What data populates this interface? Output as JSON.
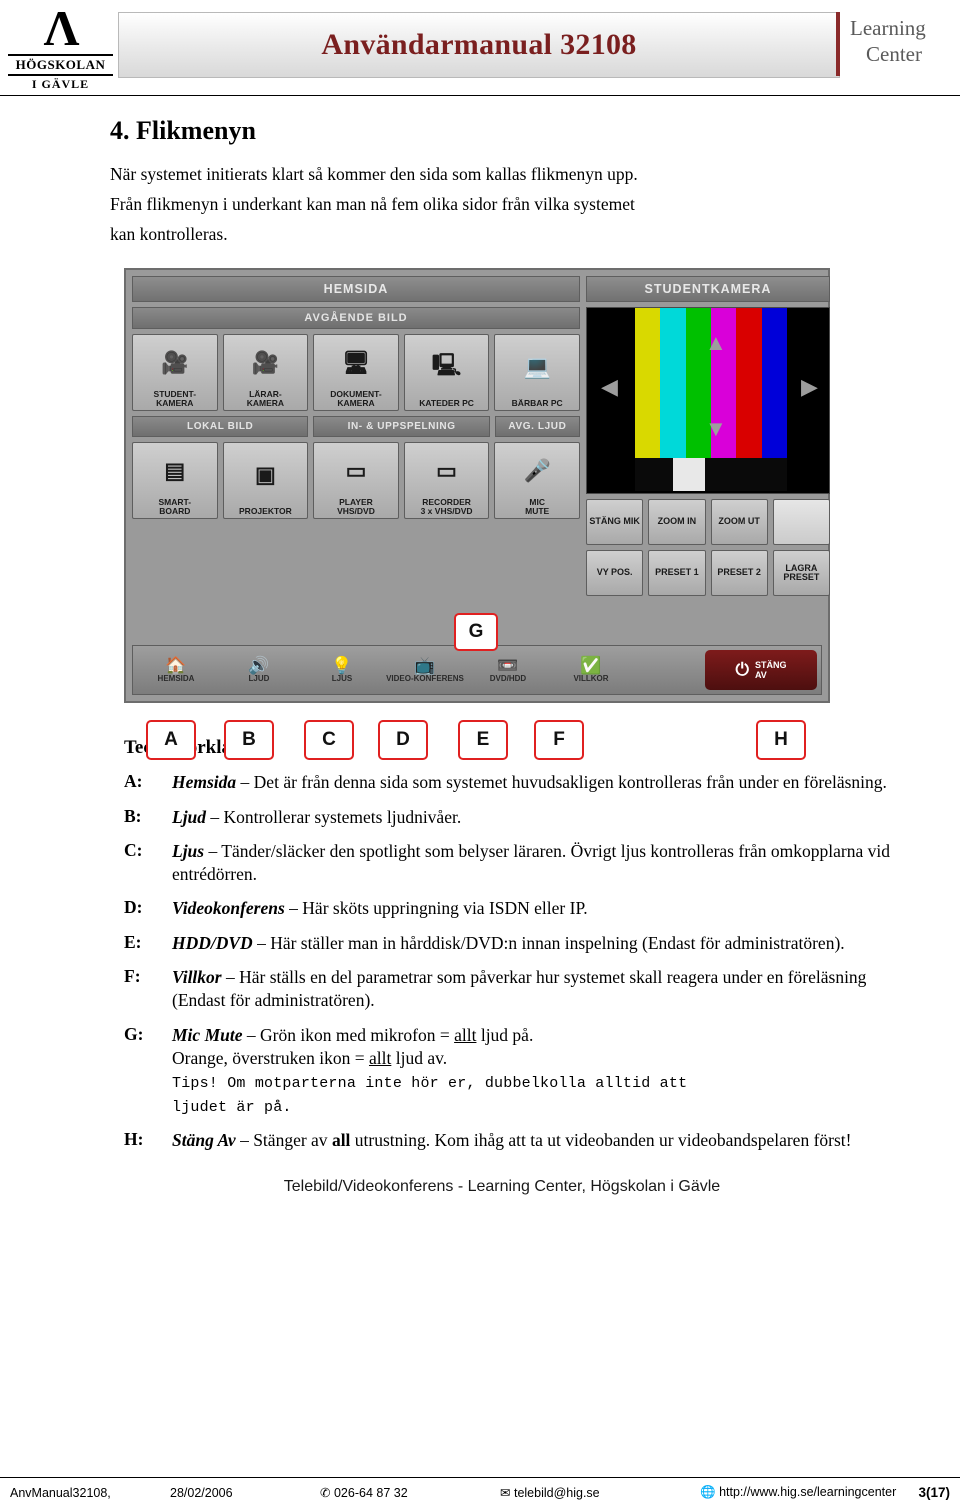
{
  "header": {
    "university_mark": "Λ",
    "university_name": "HÖGSKOLAN",
    "university_city": "I GÄVLE",
    "doc_title": "Användarmanual 32108",
    "lc_line1": "Learning",
    "lc_line2": "Center"
  },
  "section": {
    "heading": "4. Flikmenyn",
    "intro_line1": "När systemet initierats klart så kommer den sida som kallas flikmenyn upp.",
    "intro_line2": "Från flikmenyn i underkant kan man nå fem olika sidor från vilka systemet",
    "intro_line3": "kan kontrolleras."
  },
  "panel": {
    "tab_home": "HEMSIDA",
    "tab_student_camera": "STUDENTKAMERA",
    "sub_outgoing": "AVGÅENDE BILD",
    "sources": [
      {
        "line1": "STUDENT-",
        "line2": "KAMERA",
        "icon": "camera-icon"
      },
      {
        "line1": "LÄRAR-",
        "line2": "KAMERA",
        "icon": "camera-icon"
      },
      {
        "line1": "DOKUMENT-",
        "line2": "KAMERA",
        "icon": "document-camera-icon"
      },
      {
        "line1": "KATEDER PC",
        "line2": "",
        "icon": "desktop-pc-icon"
      },
      {
        "line1": "BÄRBAR PC",
        "line2": "",
        "icon": "laptop-icon"
      }
    ],
    "sub_local": "LOKAL BILD",
    "sub_inrec": "IN- & UPPSPELNING",
    "sub_audio": "AVG. LJUD",
    "local_buttons": [
      {
        "line1": "SMART-",
        "line2": "BOARD",
        "icon": "smartboard-icon"
      },
      {
        "line1": "PROJEKTOR",
        "line2": "",
        "icon": "projector-icon"
      },
      {
        "line1": "PLAYER",
        "line2": "VHS/DVD",
        "icon": "vhs-player-icon"
      },
      {
        "line1": "RECORDER",
        "line2": "3 x VHS/DVD",
        "icon": "recorder-icon"
      },
      {
        "line1": "MIC",
        "line2": "MUTE",
        "icon": "microphone-icon"
      }
    ],
    "camera_controls": [
      "STÄNG MIK",
      "ZOOM IN",
      "ZOOM UT",
      "",
      "VY POS.",
      "PRESET 1",
      "PRESET 2",
      "LAGRA PRESET"
    ],
    "tabs": [
      {
        "label": "HEMSIDA",
        "icon": "home-icon"
      },
      {
        "label": "LJUD",
        "icon": "speaker-icon"
      },
      {
        "label": "LJUS",
        "icon": "lightbulb-icon"
      },
      {
        "label": "VIDEO-KONFERENS",
        "icon": "videoconference-icon"
      },
      {
        "label": "DVD/HDD",
        "icon": "dvd-icon"
      },
      {
        "label": "VILLKOR",
        "icon": "checkmark-icon"
      }
    ],
    "off_button_line1": "STÄNG",
    "off_button_line2": "AV",
    "off_button_icon": "power-icon",
    "callout_g": "G",
    "callout_letters": [
      "A",
      "B",
      "C",
      "D",
      "E",
      "F",
      "H"
    ],
    "callout_accent_color": "#e02020"
  },
  "legend": {
    "heading": "Teckenförklaring:",
    "items": [
      {
        "key": "A:",
        "term": "Hemsida",
        "text": " – Det är från denna sida som systemet huvudsakligen kontrolleras från under en föreläsning."
      },
      {
        "key": "B:",
        "term": "Ljud",
        "text": " – Kontrollerar systemets ljudnivåer."
      },
      {
        "key": "C:",
        "term": "Ljus",
        "text": " – Tänder/släcker den spotlight som belyser läraren. Övrigt ljus kontrolleras från omkopplarna vid entrédörren."
      },
      {
        "key": "D:",
        "term": "Videokonferens",
        "text": " – Här sköts uppringning via ISDN eller IP."
      },
      {
        "key": "E:",
        "term": "HDD/DVD",
        "text": " – Här ställer man in hårddisk/DVD:n innan inspelning (Endast för administratören)."
      },
      {
        "key": "F:",
        "term": "Villkor",
        "text": " – Här ställs en del parametrar som påverkar hur systemet skall reagera under en föreläsning (Endast för administratören)."
      },
      {
        "key": "G:",
        "term": "Mic Mute",
        "text_pre": " – Grön ikon med mikrofon = ",
        "underline1": "allt",
        "text_mid": " ljud på.",
        "line2_pre": "Orange, överstruken ikon = ",
        "underline2": "allt",
        "line2_post": " ljud av.",
        "tips_line1": "Tips! Om motparterna inte hör er, dubbelkolla alltid att",
        "tips_line2": "ljudet är på."
      },
      {
        "key": "H:",
        "term": "Stäng Av",
        "text_pre": " – Stänger av ",
        "bold": "all",
        "text_post": " utrustning. Kom ihåg att ta ut videobanden ur videobandspelaren först!"
      }
    ]
  },
  "footer": {
    "center_title": "Telebild/Videokonferens - Learning Center, Högskolan i Gävle",
    "doc_id": "AnvManual32108,",
    "date": "28/02/2006",
    "phone_icon": "phone-icon",
    "phone": "026-64 87 32",
    "mail_icon": "mail-icon",
    "email": "telebild@hig.se",
    "globe_icon": "globe-icon",
    "url": "http://www.hig.se/learningcenter",
    "page": "3(17)"
  }
}
